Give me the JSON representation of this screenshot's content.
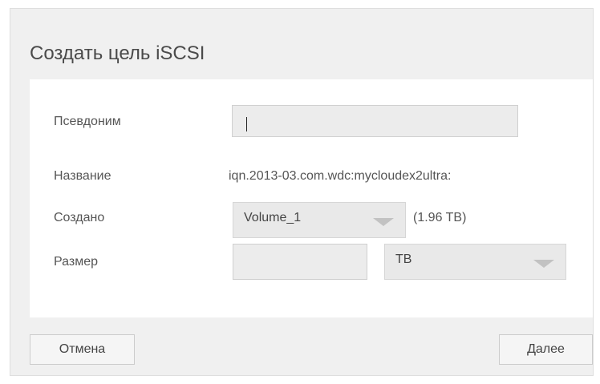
{
  "dialog": {
    "title": "Создать цель iSCSI"
  },
  "form": {
    "alias": {
      "label": "Псевдоним",
      "value": ""
    },
    "name": {
      "label": "Название",
      "value": "iqn.2013-03.com.wdc:mycloudex2ultra:"
    },
    "created_on": {
      "label": "Создано",
      "selected": "Volume_1",
      "capacity": "(1.96 TB)"
    },
    "size": {
      "label": "Размер",
      "value": "",
      "unit": "TB"
    }
  },
  "buttons": {
    "cancel": "Отмена",
    "next": "Далее"
  },
  "icons": {
    "dropdown": "chevron-down-icon"
  },
  "colors": {
    "dialog_background": "#f0f0f0",
    "panel_background": "#ffffff",
    "input_background": "#ececec"
  }
}
